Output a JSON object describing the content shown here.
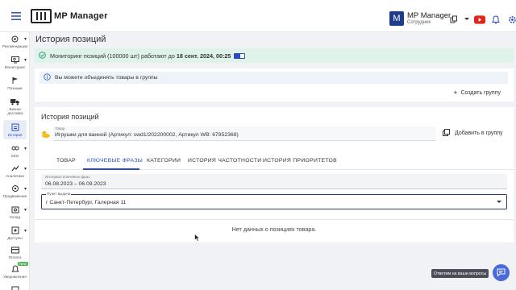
{
  "app": {
    "title": "MP Manager"
  },
  "user": {
    "initial": "M",
    "name": "MP Manager",
    "role": "Сотрудник"
  },
  "top_icons": [
    "copy-icon",
    "youtube-icon",
    "bell-icon",
    "settings-icon"
  ],
  "sidebar": {
    "items": [
      {
        "label": "Рекомендации",
        "icon": "recommendations-icon",
        "caret": true
      },
      {
        "label": "Мониторинг",
        "icon": "monitor-icon",
        "caret": true
      },
      {
        "label": "Позиции",
        "icon": "positions-icon",
        "caret": false
      },
      {
        "label": "Бизнес доставка",
        "icon": "truck-icon",
        "caret": false
      },
      {
        "label": "История",
        "icon": "history-icon",
        "caret": false,
        "active": true
      },
      {
        "label": "SEO",
        "icon": "seo-icon",
        "caret": true
      },
      {
        "label": "Аналитика",
        "icon": "analytics-icon",
        "caret": true
      },
      {
        "label": "Продвижение",
        "icon": "promotion-icon",
        "caret": true
      },
      {
        "label": "Склад",
        "icon": "warehouse-icon",
        "caret": true
      },
      {
        "label": "Доступы",
        "icon": "access-icon",
        "caret": true
      },
      {
        "label": "Оплата",
        "icon": "payment-icon",
        "caret": false
      },
      {
        "label": "Уведомления",
        "icon": "notifications-icon",
        "caret": false,
        "badge": "New"
      }
    ]
  },
  "page": {
    "title": "История позиций",
    "monitoring_notice": {
      "text": "Мониторинг позиций (100000 шт) работают до",
      "date": "18 сент. 2024, 00:25"
    },
    "info_notice": "Вы можете объединять товары в группы",
    "create_group": "Создать группу",
    "history_title": "История позиций",
    "product": {
      "label": "Товар",
      "value": "Игрушки для ванной (Артикул: swd1/202200002, Артикул WB: 67852368)"
    },
    "add_to_group": "Добавить в группу",
    "tabs": [
      {
        "label": "ТОВАР",
        "active": false
      },
      {
        "label": "КЛЮЧЕВЫЕ ФРАЗЫ",
        "active": true
      },
      {
        "label": "КАТЕГОРИИ",
        "active": false
      },
      {
        "label": "ИСТОРИЯ ЧАСТОТНОСТИ",
        "active": false
      },
      {
        "label": "ИСТОРИЯ ПРИОРИТЕТОВ",
        "active": false
      }
    ],
    "range": {
      "label": "Интервал ключевых фраз",
      "value": "06.08.2023 – 06.09.2023"
    },
    "pickup": {
      "label": "Пункт выдачи",
      "value": "г Санкт-Петербург, Галерная 11"
    },
    "empty_text": "Нет данных о позициях товара."
  },
  "chat": {
    "tooltip": "Ответим на ваши вопросы"
  },
  "colors": {
    "accent": "#2a4cc0",
    "success_bg": "#dff3ea",
    "info_bg": "#eef3fa",
    "chat": "#4a6bd9"
  }
}
